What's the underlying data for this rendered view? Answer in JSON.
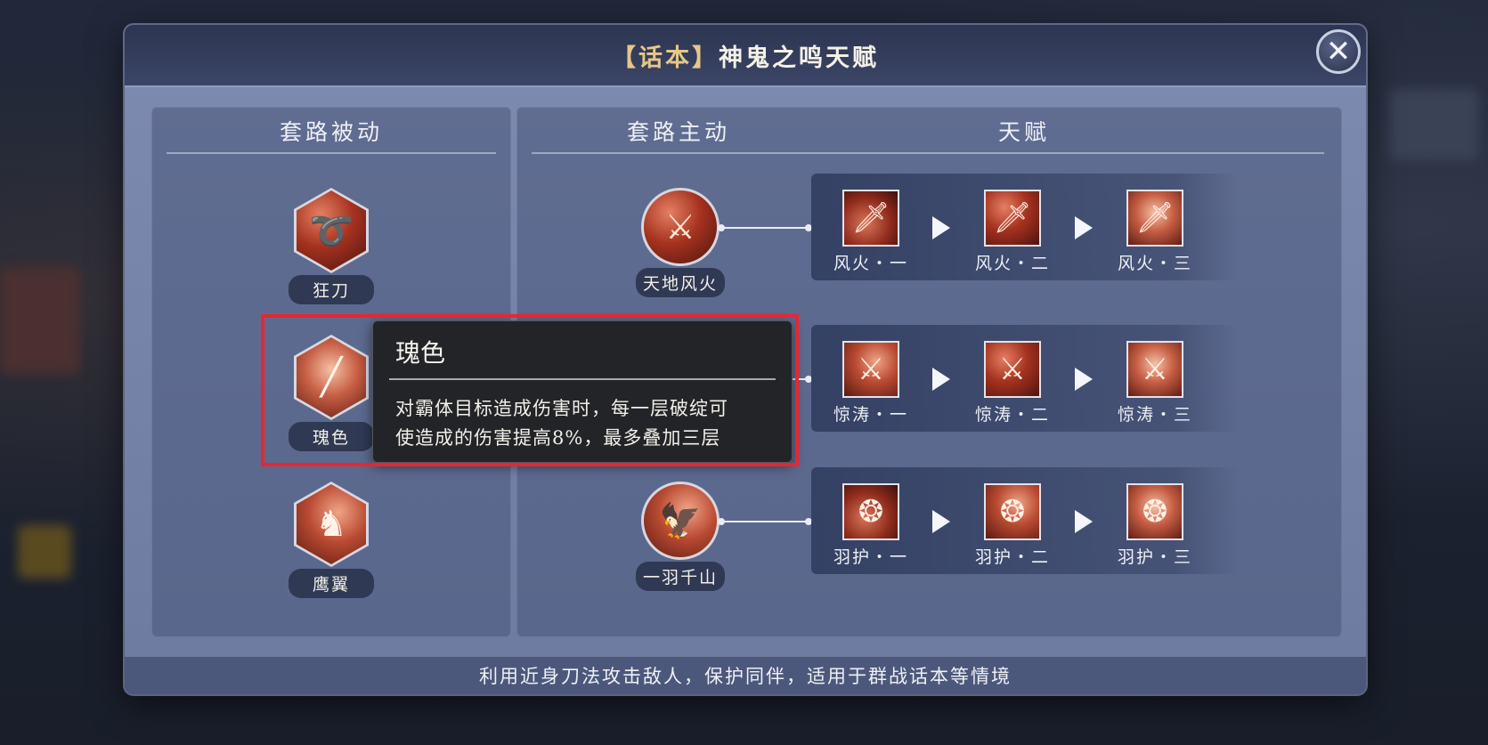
{
  "dialog": {
    "title_bracket_open": "【",
    "title_tag": "话本",
    "title_bracket_close": "】",
    "title_main": "神鬼之鸣天赋",
    "close_glyph": "✕"
  },
  "left_panel": {
    "header": "套路被动",
    "skills": [
      {
        "label": "狂刀",
        "icon": "slash-swirl-icon",
        "glyph": "➰"
      },
      {
        "label": "瑰色",
        "icon": "light-slash-icon",
        "glyph": "╱"
      },
      {
        "label": "鹰翼",
        "icon": "warrior-silhouette-icon",
        "glyph": "♞"
      }
    ]
  },
  "right_panel": {
    "header_active": "套路主动",
    "header_talent": "天赋",
    "rows": [
      {
        "active_label": "天地风火",
        "active_icon": "sword-vortex-icon",
        "active_glyph": "⚔",
        "talents": [
          {
            "label": "风火・一",
            "icon": "sword-icon",
            "glyph": "🗡"
          },
          {
            "label": "风火・二",
            "icon": "sword-icon",
            "glyph": "🗡"
          },
          {
            "label": "风火・三",
            "icon": "sword-icon",
            "glyph": "🗡"
          }
        ]
      },
      {
        "active_label": "",
        "active_icon": "hidden-skill-icon",
        "active_glyph": "",
        "talents": [
          {
            "label": "惊涛・一",
            "icon": "sword-slash-icon",
            "glyph": "⚔"
          },
          {
            "label": "惊涛・二",
            "icon": "sword-slash-icon",
            "glyph": "⚔"
          },
          {
            "label": "惊涛・三",
            "icon": "sword-slash-icon",
            "glyph": "⚔"
          }
        ]
      },
      {
        "active_label": "一羽千山",
        "active_icon": "eagle-strike-icon",
        "active_glyph": "🦅",
        "talents": [
          {
            "label": "羽护・一",
            "icon": "feather-swirl-icon",
            "glyph": "❂"
          },
          {
            "label": "羽护・二",
            "icon": "feather-swirl-icon",
            "glyph": "❂"
          },
          {
            "label": "羽护・三",
            "icon": "feather-swirl-icon",
            "glyph": "❂"
          }
        ]
      }
    ]
  },
  "tooltip": {
    "title": "瑰色",
    "line1": "对霸体目标造成伤害时，每一层破绽可",
    "line2": "使造成的伤害提高8%，最多叠加三层"
  },
  "footer": {
    "description": "利用近身刀法攻击敌人，保护同伴，适用于群战话本等情境"
  },
  "colors": {
    "highlight": "#e8262f",
    "title_accent": "#e7c787"
  }
}
